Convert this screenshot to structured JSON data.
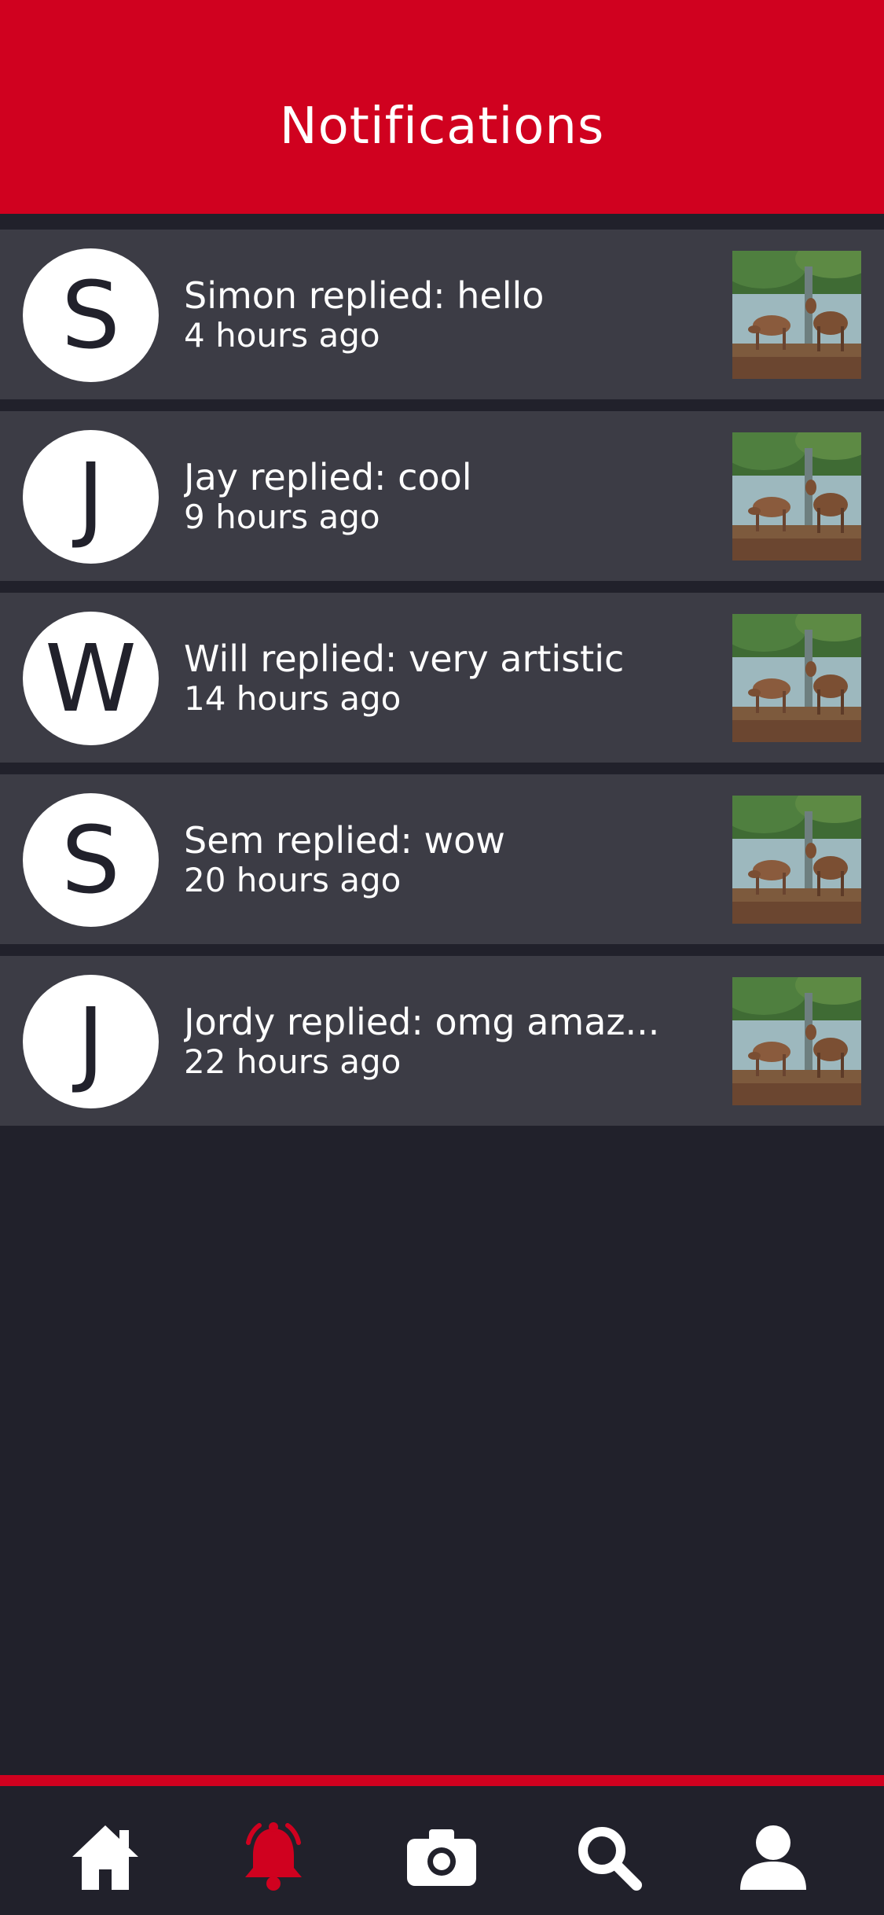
{
  "header": {
    "title": "Notifications"
  },
  "notifications": [
    {
      "initial": "S",
      "message": "Simon replied: hello",
      "time": "4 hours ago"
    },
    {
      "initial": "J",
      "message": "Jay replied: cool",
      "time": "9 hours ago"
    },
    {
      "initial": "W",
      "message": "Will replied: very artistic",
      "time": "14 hours ago"
    },
    {
      "initial": "S",
      "message": "Sem replied: wow",
      "time": "20 hours ago"
    },
    {
      "initial": "J",
      "message": "Jordy replied: omg amaz...",
      "time": "22 hours ago"
    }
  ],
  "nav": {
    "items": [
      {
        "icon": "home-icon",
        "active": false
      },
      {
        "icon": "bell-icon",
        "active": true
      },
      {
        "icon": "camera-icon",
        "active": false
      },
      {
        "icon": "search-icon",
        "active": false
      },
      {
        "icon": "user-icon",
        "active": false
      }
    ]
  },
  "colors": {
    "accent": "#d0011f",
    "background": "#21212b",
    "row": "#3c3c45",
    "text": "#ffffff"
  }
}
